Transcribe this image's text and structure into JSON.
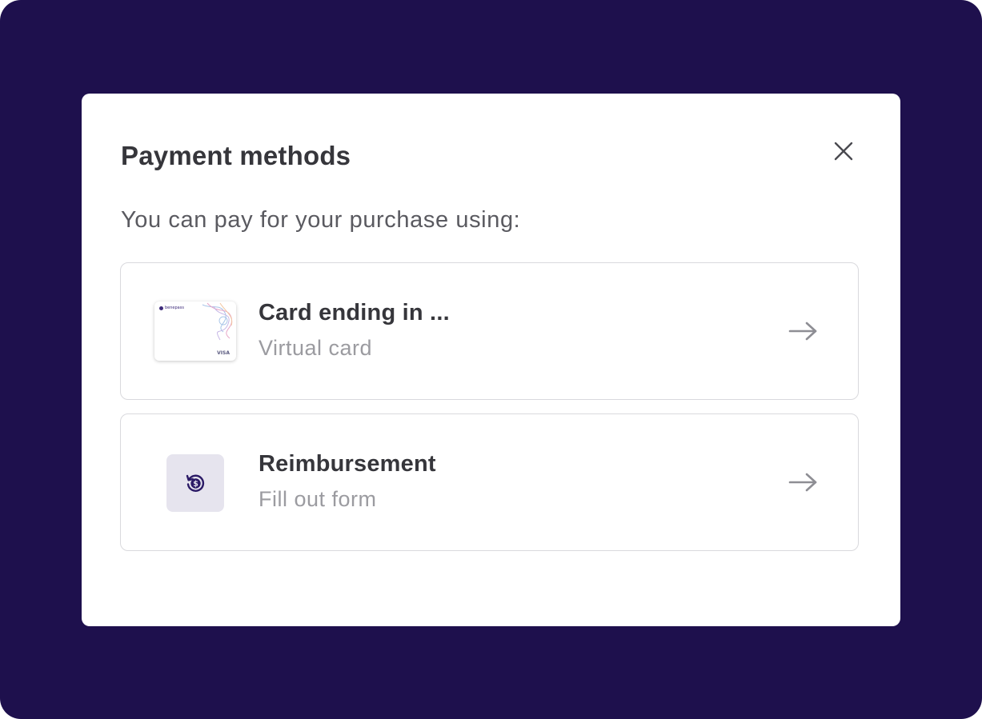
{
  "modal": {
    "title": "Payment methods",
    "subtitle": "You can pay for your purchase using:"
  },
  "options": [
    {
      "title": "Card ending in ...",
      "subtitle": "Virtual card",
      "icon": "virtual-card-image",
      "card_thumb": {
        "brand": "benepass",
        "network": "VISA"
      }
    },
    {
      "title": "Reimbursement",
      "subtitle": "Fill out form",
      "icon": "reimbursement-dollar-refresh-icon"
    }
  ],
  "colors": {
    "backdrop": "#1e104d",
    "accent": "#2b1a66",
    "text_primary": "#36363b",
    "text_muted": "#9b9ba0"
  }
}
